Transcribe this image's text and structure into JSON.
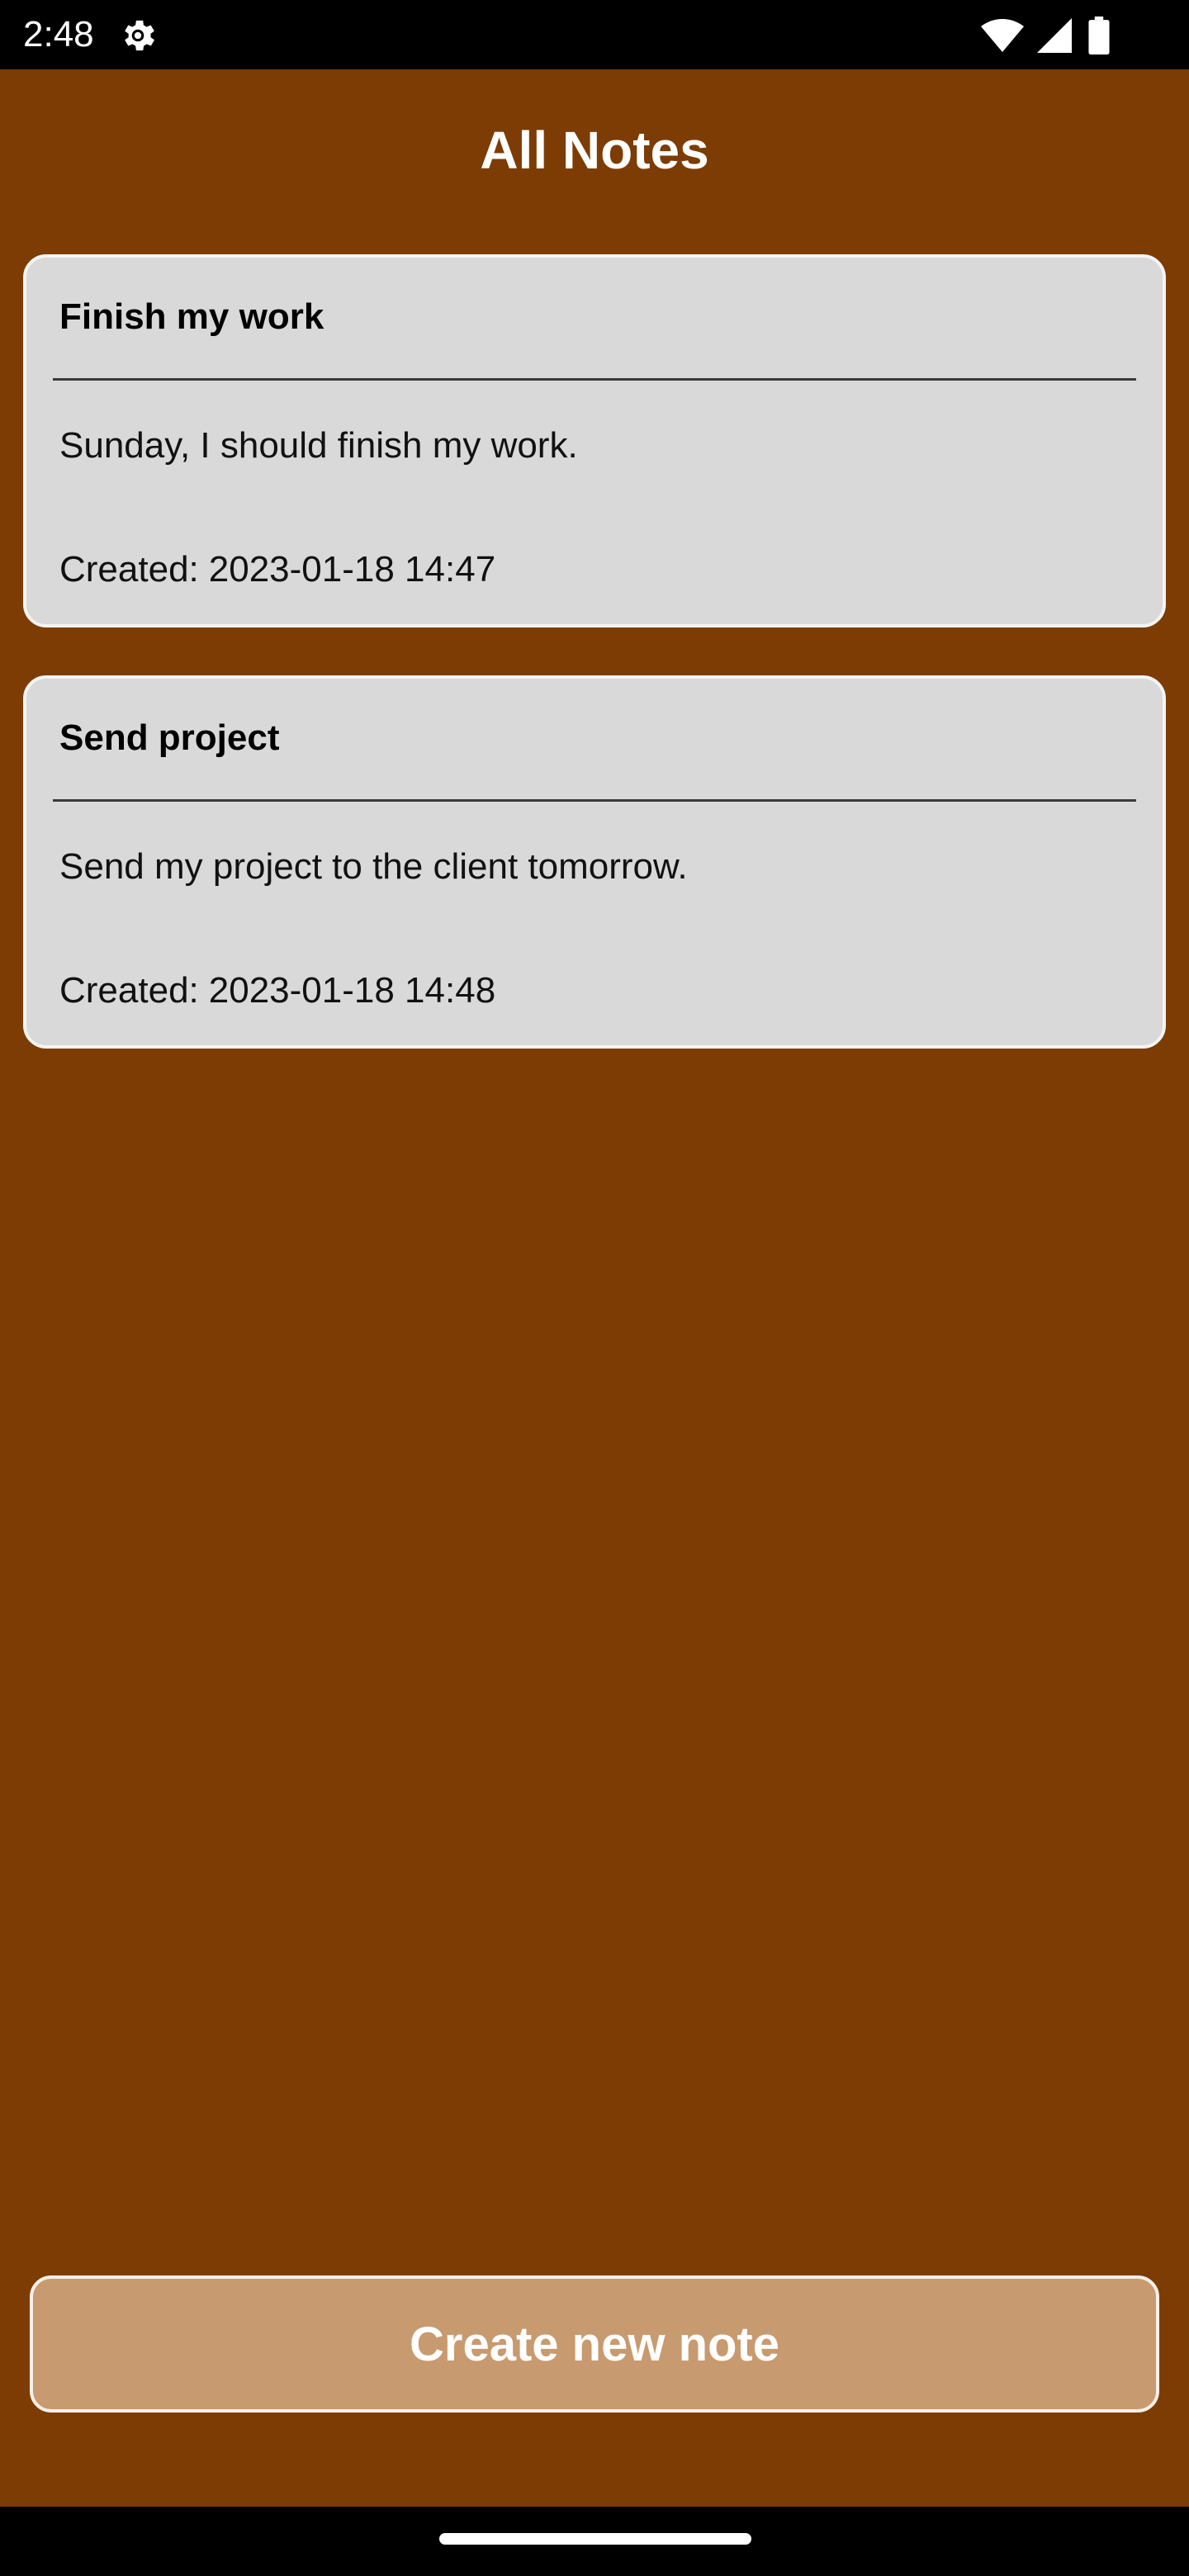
{
  "status_bar": {
    "time": "2:48",
    "icons": [
      "settings-gear-icon",
      "wifi-icon",
      "cellular-signal-icon",
      "battery-icon"
    ]
  },
  "header": {
    "title": "All Notes"
  },
  "notes": [
    {
      "title": "Finish my work",
      "body": "Sunday, I should finish my work.",
      "created_label": "Created:",
      "created_value": "2023-01-18 14:47"
    },
    {
      "title": "Send project",
      "body": "Send my project to the client tomorrow.",
      "created_label": "Created:",
      "created_value": "2023-01-18 14:48"
    }
  ],
  "actions": {
    "create_label": "Create new note"
  },
  "colors": {
    "background": "#7c3c03",
    "card": "#d9d9d9",
    "button": "#c89a6f"
  }
}
